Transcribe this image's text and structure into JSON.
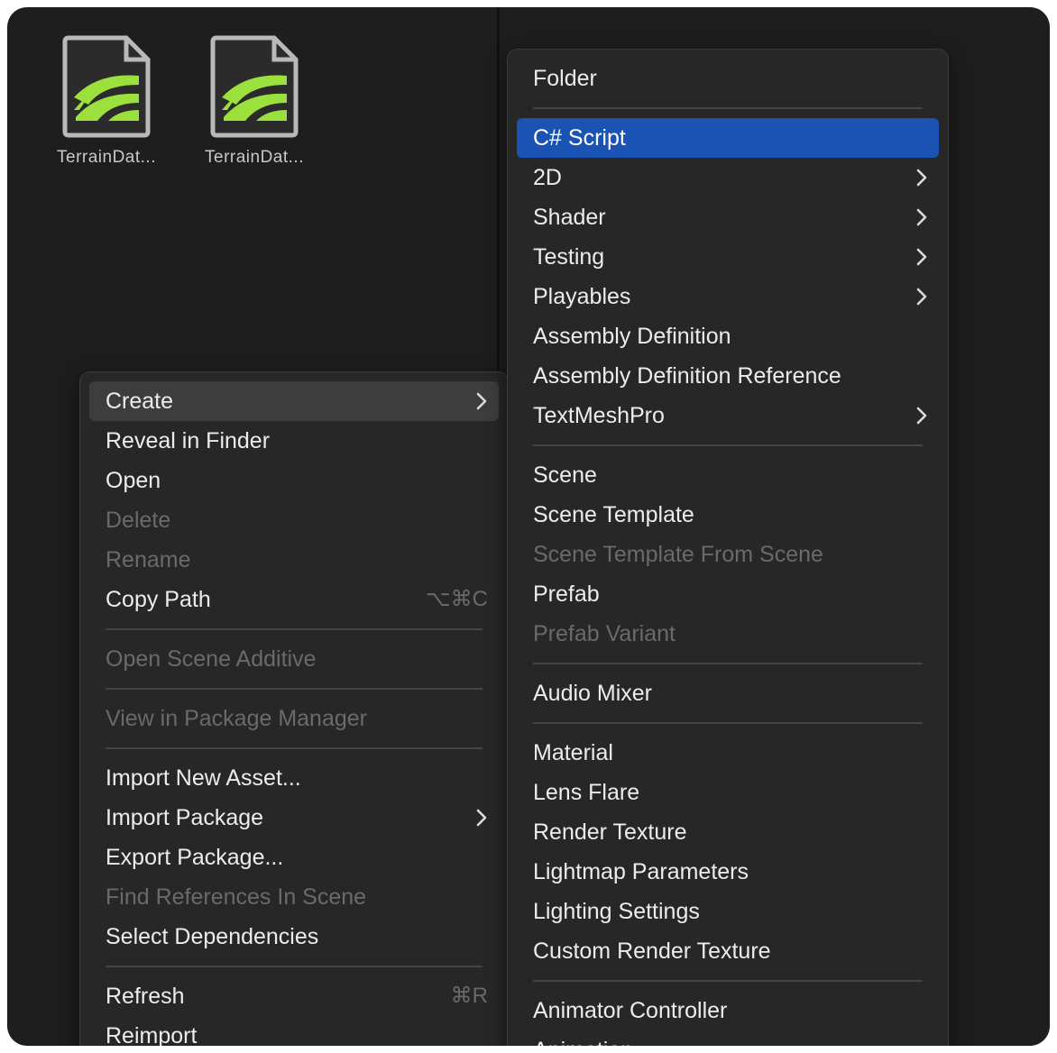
{
  "assets": [
    {
      "label": "TerrainDat..."
    },
    {
      "label": "TerrainDat..."
    }
  ],
  "context_menu": {
    "groups": [
      [
        {
          "label": "Create",
          "submenu": true,
          "state": "hovered"
        },
        {
          "label": "Reveal in Finder"
        },
        {
          "label": "Open"
        },
        {
          "label": "Delete",
          "disabled": true
        },
        {
          "label": "Rename",
          "disabled": true
        },
        {
          "label": "Copy Path",
          "shortcut": "⌥⌘C"
        }
      ],
      [
        {
          "label": "Open Scene Additive",
          "disabled": true
        }
      ],
      [
        {
          "label": "View in Package Manager",
          "disabled": true
        }
      ],
      [
        {
          "label": "Import New Asset..."
        },
        {
          "label": "Import Package",
          "submenu": true
        },
        {
          "label": "Export Package..."
        },
        {
          "label": "Find References In Scene",
          "disabled": true
        },
        {
          "label": "Select Dependencies"
        }
      ],
      [
        {
          "label": "Refresh",
          "shortcut": "⌘R"
        },
        {
          "label": "Reimport"
        }
      ]
    ]
  },
  "create_submenu": {
    "groups": [
      [
        {
          "label": "Folder"
        }
      ],
      [
        {
          "label": "C# Script",
          "state": "selected"
        },
        {
          "label": "2D",
          "submenu": true
        },
        {
          "label": "Shader",
          "submenu": true
        },
        {
          "label": "Testing",
          "submenu": true
        },
        {
          "label": "Playables",
          "submenu": true
        },
        {
          "label": "Assembly Definition"
        },
        {
          "label": "Assembly Definition Reference"
        },
        {
          "label": "TextMeshPro",
          "submenu": true
        }
      ],
      [
        {
          "label": "Scene"
        },
        {
          "label": "Scene Template"
        },
        {
          "label": "Scene Template From Scene",
          "disabled": true
        },
        {
          "label": "Prefab"
        },
        {
          "label": "Prefab Variant",
          "disabled": true
        }
      ],
      [
        {
          "label": "Audio Mixer"
        }
      ],
      [
        {
          "label": "Material"
        },
        {
          "label": "Lens Flare"
        },
        {
          "label": "Render Texture"
        },
        {
          "label": "Lightmap Parameters"
        },
        {
          "label": "Lighting Settings"
        },
        {
          "label": "Custom Render Texture"
        }
      ],
      [
        {
          "label": "Animator Controller"
        },
        {
          "label": "Animation"
        }
      ]
    ]
  },
  "colors": {
    "background": "#1e1e1e",
    "menu": "#272727",
    "selected": "#1a53b3",
    "hovered": "#3d3d3d",
    "text": "#ececec",
    "disabled_text": "#6a6a6a",
    "terrain_green": "#9be03c"
  },
  "icons": {
    "submenu": "chevron-right-icon",
    "asset": "terrain-data-icon"
  }
}
